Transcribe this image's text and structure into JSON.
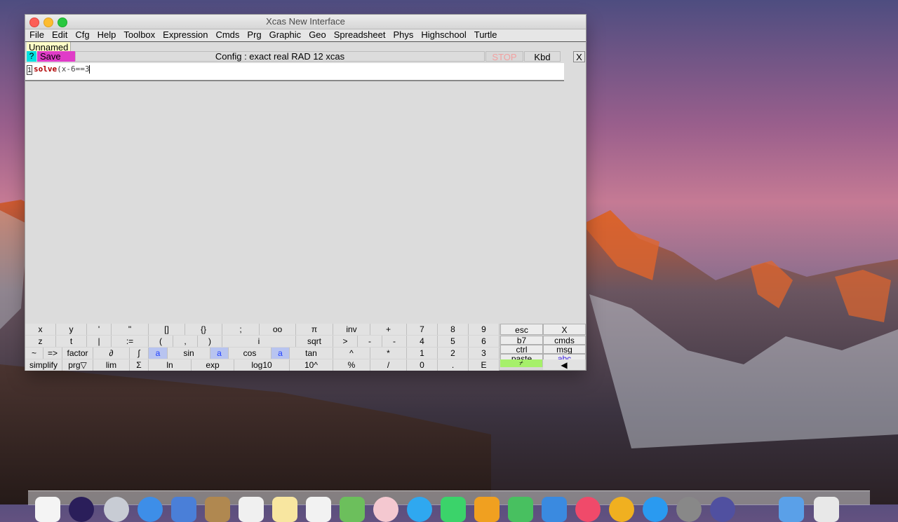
{
  "window": {
    "title": "Xcas New Interface"
  },
  "menu": [
    "File",
    "Edit",
    "Cfg",
    "Help",
    "Toolbox",
    "Expression",
    "Cmds",
    "Prg",
    "Graphic",
    "Geo",
    "Spreadsheet",
    "Phys",
    "Highschool",
    "Turtle"
  ],
  "tab": {
    "label": "Unnamed"
  },
  "toolbar": {
    "help_label": "?",
    "save_label": "Save",
    "config_text": "Config  : exact real RAD 12 xcas",
    "stop_label": "STOP",
    "kbd_label": "Kbd",
    "close_label": "X"
  },
  "session": {
    "line_number": "1",
    "command_keyword": "solve",
    "command_rest": "(x-6==3"
  },
  "keyboard": {
    "row1": [
      "x",
      "y",
      "'",
      "\"",
      "[]",
      "{}",
      ";",
      "oo",
      "π",
      "inv",
      "+",
      "7",
      "8",
      "9",
      "esc",
      "X"
    ],
    "row2": [
      "z",
      "t",
      "|",
      ":=",
      "(",
      ",",
      ")",
      "i",
      "sqrt",
      ">",
      "-",
      "-",
      "4",
      "5",
      "6",
      "b7",
      "cmds"
    ],
    "row3": [
      "~",
      "=>",
      "factor",
      "∂",
      "∫",
      "a",
      "sin",
      "a",
      "cos",
      "a",
      "tan",
      "^",
      "*",
      "1",
      "2",
      "3",
      "ctrl",
      "msg"
    ],
    "row4": [
      "simplify",
      "prg▽",
      "lim",
      "Σ",
      "ln",
      "exp",
      "log10",
      "10^",
      "%",
      "/",
      "0",
      ".",
      "E",
      "⌿",
      "abc"
    ],
    "paste_label": "paste",
    "arrow_label": "◀"
  },
  "colors": {
    "help_button": "#00e0e0",
    "save_button": "#e03cc8",
    "stop_text": "#f2a0a0",
    "keyword": "#b00000",
    "paste_key": "#a6f06a"
  }
}
